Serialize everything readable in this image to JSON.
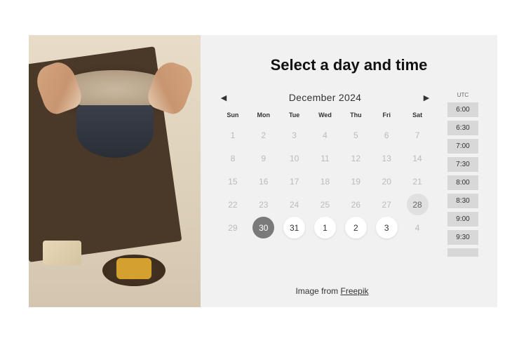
{
  "title": "Select a day and time",
  "calendar": {
    "month_label": "December  2024",
    "dow": [
      "Sun",
      "Mon",
      "Tue",
      "Wed",
      "Thu",
      "Fri",
      "Sat"
    ],
    "days": [
      {
        "n": "1",
        "cls": "d-out"
      },
      {
        "n": "2",
        "cls": "d-out"
      },
      {
        "n": "3",
        "cls": "d-out"
      },
      {
        "n": "4",
        "cls": "d-out"
      },
      {
        "n": "5",
        "cls": "d-out"
      },
      {
        "n": "6",
        "cls": "d-out"
      },
      {
        "n": "7",
        "cls": "d-out"
      },
      {
        "n": "8",
        "cls": "d-out"
      },
      {
        "n": "9",
        "cls": "d-out"
      },
      {
        "n": "10",
        "cls": "d-out"
      },
      {
        "n": "11",
        "cls": "d-out"
      },
      {
        "n": "12",
        "cls": "d-out"
      },
      {
        "n": "13",
        "cls": "d-out"
      },
      {
        "n": "14",
        "cls": "d-out"
      },
      {
        "n": "15",
        "cls": "d-out"
      },
      {
        "n": "16",
        "cls": "d-out"
      },
      {
        "n": "17",
        "cls": "d-out"
      },
      {
        "n": "18",
        "cls": "d-out"
      },
      {
        "n": "19",
        "cls": "d-out"
      },
      {
        "n": "20",
        "cls": "d-out"
      },
      {
        "n": "21",
        "cls": "d-out"
      },
      {
        "n": "22",
        "cls": "d-out"
      },
      {
        "n": "23",
        "cls": "d-out"
      },
      {
        "n": "24",
        "cls": "d-out"
      },
      {
        "n": "25",
        "cls": "d-out"
      },
      {
        "n": "26",
        "cls": "d-out"
      },
      {
        "n": "27",
        "cls": "d-out"
      },
      {
        "n": "28",
        "cls": "d-today"
      },
      {
        "n": "29",
        "cls": "d-out"
      },
      {
        "n": "30",
        "cls": "d-sel"
      },
      {
        "n": "31",
        "cls": "d-avail"
      },
      {
        "n": "1",
        "cls": "d-avail"
      },
      {
        "n": "2",
        "cls": "d-avail"
      },
      {
        "n": "3",
        "cls": "d-avail"
      },
      {
        "n": "4",
        "cls": "d-out"
      }
    ]
  },
  "timezone": "UTC",
  "time_slots": [
    "6:00",
    "6:30",
    "7:00",
    "7:30",
    "8:00",
    "8:30",
    "9:00",
    "9:30"
  ],
  "credit": {
    "prefix": "Image from ",
    "link": "Freepik"
  }
}
